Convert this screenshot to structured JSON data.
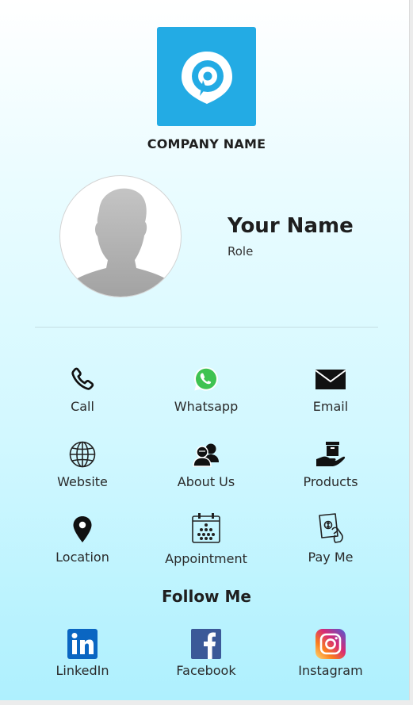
{
  "header": {
    "company_name": "COMPANY NAME",
    "logo_color": "#23abe4"
  },
  "profile": {
    "name": "Your Name",
    "role": "Role"
  },
  "actions": [
    {
      "label": "Call",
      "icon": "phone-icon"
    },
    {
      "label": "Whatsapp",
      "icon": "whatsapp-icon"
    },
    {
      "label": "Email",
      "icon": "envelope-icon"
    },
    {
      "label": "Website",
      "icon": "globe-icon"
    },
    {
      "label": "About Us",
      "icon": "people-icon"
    },
    {
      "label": "Products",
      "icon": "product-hand-icon"
    },
    {
      "label": "Location",
      "icon": "map-pin-icon"
    },
    {
      "label": "Appointment",
      "icon": "calendar-icon"
    },
    {
      "label": "Pay Me",
      "icon": "payment-icon"
    }
  ],
  "social": {
    "title": "Follow Me",
    "items": [
      {
        "label": "LinkedIn",
        "icon": "linkedin-icon",
        "color": "#0a66c2"
      },
      {
        "label": "Facebook",
        "icon": "facebook-icon",
        "color": "#3b5998"
      },
      {
        "label": "Instagram",
        "icon": "instagram-icon",
        "color": "#d62976"
      }
    ]
  }
}
